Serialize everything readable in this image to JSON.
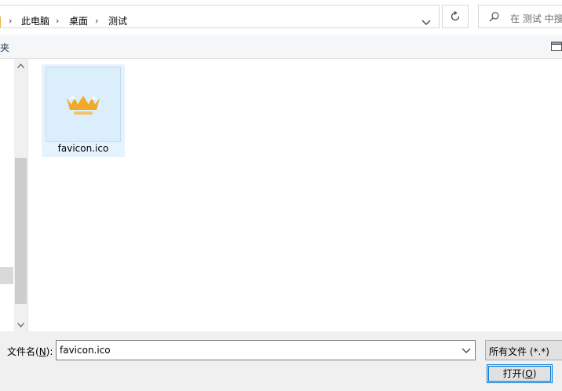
{
  "address": {
    "breadcrumbs": [
      "此电脑",
      "桌面",
      "测试"
    ],
    "separator": "›"
  },
  "search": {
    "placeholder": "在 测试 中搜"
  },
  "toolbar": {
    "new_folder_label": "件夹"
  },
  "files": [
    {
      "name": "favicon.ico",
      "icon": "favicon-thumbnail-icon",
      "selected": true
    }
  ],
  "footer": {
    "filename_label_prefix": "文件名(",
    "filename_label_key": "N",
    "filename_label_suffix": "):",
    "filename_value": "favicon.ico",
    "filetype_value": "所有文件 (*.*)",
    "open_label": "打开(",
    "open_key": "O",
    "open_suffix": ")"
  },
  "colors": {
    "selection": "#e5f3ff",
    "accent": "#0078d7",
    "folder": "#e8b84a"
  }
}
